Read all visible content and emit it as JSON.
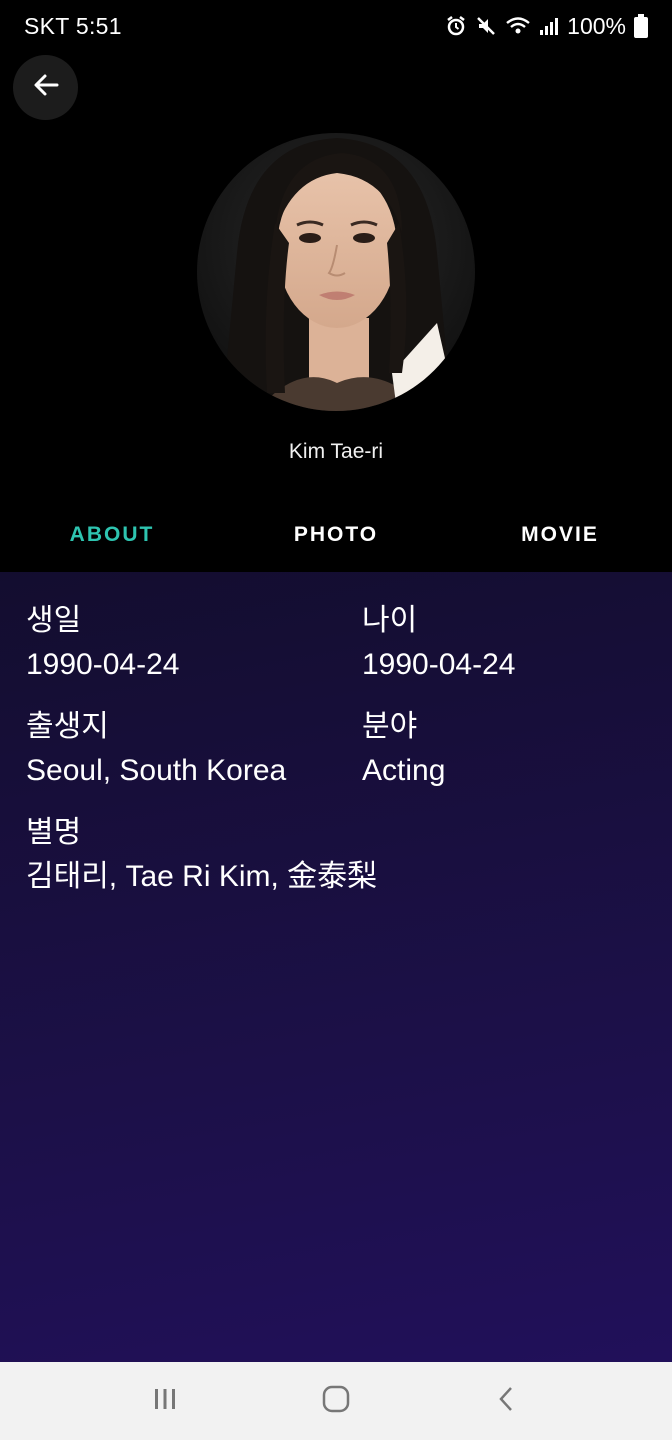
{
  "status_bar": {
    "carrier_time": "SKT 5:51",
    "battery": "100%"
  },
  "profile": {
    "name": "Kim Tae-ri"
  },
  "tabs": [
    {
      "label": "ABOUT",
      "active": true
    },
    {
      "label": "PHOTO",
      "active": false
    },
    {
      "label": "MOVIE",
      "active": false
    }
  ],
  "about": {
    "birthday_label": "생일",
    "birthday_value": "1990-04-24",
    "age_label": "나이",
    "age_value": "1990-04-24",
    "birthplace_label": "출생지",
    "birthplace_value": "Seoul, South Korea",
    "field_label": "분야",
    "field_value": "Acting",
    "alias_label": "별명",
    "alias_value": "김태리, Tae Ri Kim, 金泰梨"
  },
  "colors": {
    "accent": "#2ec4b0",
    "background_top": "#000000",
    "content_gradient_start": "#130d2f",
    "content_gradient_end": "#21105a"
  }
}
